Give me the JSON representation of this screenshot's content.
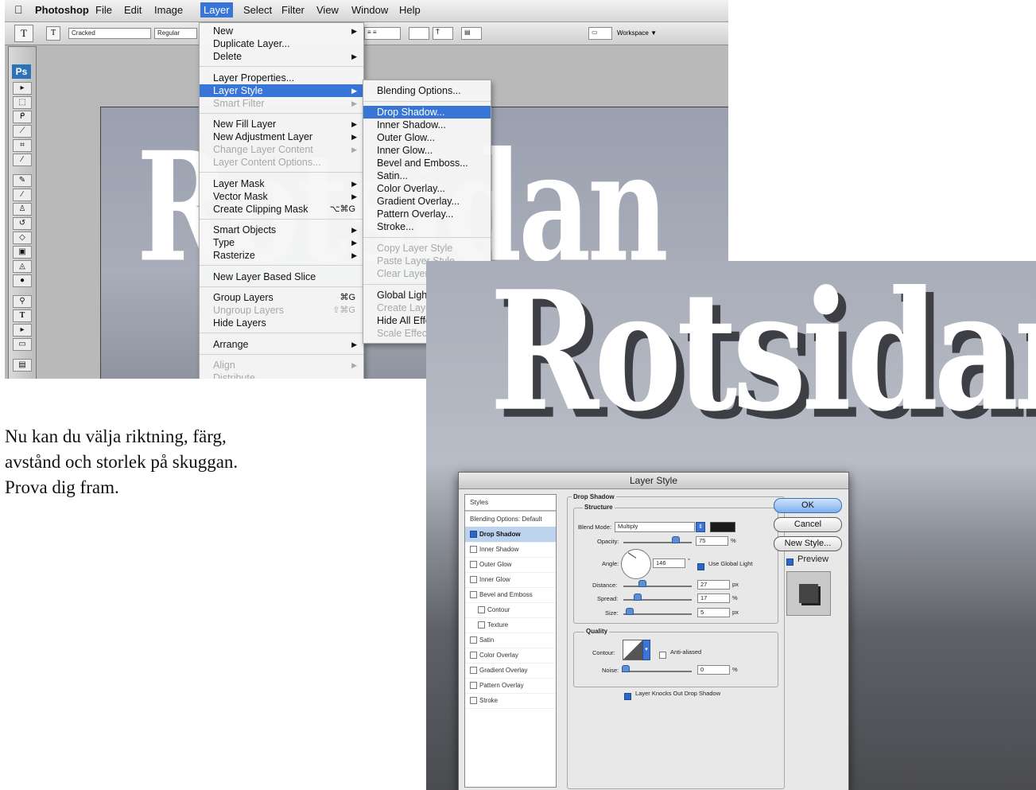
{
  "screenshot1": {
    "menubar": {
      "app": "Photoshop",
      "items": [
        "File",
        "Edit",
        "Image",
        "Layer",
        "Select",
        "Filter",
        "View",
        "Window",
        "Help"
      ],
      "active": "Layer"
    },
    "options_bar": {
      "tool_icon": "T",
      "font_family": "Cracked",
      "font_style": "Regular",
      "workspace": "Workspace ▼"
    },
    "toolbox": {
      "logo": "Ps"
    },
    "canvas_text": "Rotsidan",
    "layer_menu": [
      {
        "label": "New",
        "submenu": true
      },
      {
        "label": "Duplicate Layer..."
      },
      {
        "label": "Delete",
        "submenu": true
      },
      {
        "label": "Layer Properties..."
      },
      {
        "label": "Layer Style",
        "submenu": true,
        "highlighted": true
      },
      {
        "label": "Smart Filter",
        "disabled": true,
        "submenu": true
      },
      {
        "label": "New Fill Layer",
        "submenu": true
      },
      {
        "label": "New Adjustment Layer",
        "submenu": true
      },
      {
        "label": "Change Layer Content",
        "disabled": true,
        "submenu": true
      },
      {
        "label": "Layer Content Options...",
        "disabled": true
      },
      {
        "label": "Layer Mask",
        "submenu": true
      },
      {
        "label": "Vector Mask",
        "submenu": true
      },
      {
        "label": "Create Clipping Mask",
        "shortcut": "⌥⌘G"
      },
      {
        "label": "Smart Objects",
        "submenu": true
      },
      {
        "label": "Type",
        "submenu": true
      },
      {
        "label": "Rasterize",
        "submenu": true
      },
      {
        "label": "New Layer Based Slice"
      },
      {
        "label": "Group Layers",
        "shortcut": "⌘G"
      },
      {
        "label": "Ungroup Layers",
        "disabled": true,
        "shortcut": "⇧⌘G"
      },
      {
        "label": "Hide Layers"
      },
      {
        "label": "Arrange",
        "submenu": true
      },
      {
        "label": "Align",
        "disabled": true,
        "submenu": true
      },
      {
        "label": "Distribute",
        "disabled": true
      }
    ],
    "layer_style_submenu": [
      {
        "label": "Blending Options..."
      },
      {
        "label": "Drop Shadow...",
        "highlighted": true
      },
      {
        "label": "Inner Shadow..."
      },
      {
        "label": "Outer Glow..."
      },
      {
        "label": "Inner Glow..."
      },
      {
        "label": "Bevel and Emboss..."
      },
      {
        "label": "Satin..."
      },
      {
        "label": "Color Overlay..."
      },
      {
        "label": "Gradient Overlay..."
      },
      {
        "label": "Pattern Overlay..."
      },
      {
        "label": "Stroke..."
      },
      {
        "label": "Copy Layer Style",
        "disabled": true
      },
      {
        "label": "Paste Layer Style",
        "disabled": true
      },
      {
        "label": "Clear Layer Style",
        "disabled": true
      },
      {
        "label": "Global Light..."
      },
      {
        "label": "Create Layers",
        "disabled": true
      },
      {
        "label": "Hide All Effects"
      },
      {
        "label": "Scale Effects...",
        "disabled": true
      }
    ]
  },
  "instruction_text": [
    "Nu kan du välja riktning, färg,",
    "avstånd och storlek på skuggan.",
    "Prova dig fram."
  ],
  "screenshot2": {
    "canvas_text": "Rotsidan",
    "dialog": {
      "title": "Layer Style",
      "styles_header": "Styles",
      "style_items": [
        {
          "label": "Blending Options: Default",
          "checkbox": false
        },
        {
          "label": "Drop Shadow",
          "checkbox": true,
          "checked": true,
          "selected": true
        },
        {
          "label": "Inner Shadow",
          "checkbox": true,
          "checked": false
        },
        {
          "label": "Outer Glow",
          "checkbox": true,
          "checked": false
        },
        {
          "label": "Inner Glow",
          "checkbox": true,
          "checked": false
        },
        {
          "label": "Bevel and Emboss",
          "checkbox": true,
          "checked": false
        },
        {
          "label": "Contour",
          "checkbox": true,
          "checked": false,
          "indent": true
        },
        {
          "label": "Texture",
          "checkbox": true,
          "checked": false,
          "indent": true
        },
        {
          "label": "Satin",
          "checkbox": true,
          "checked": false
        },
        {
          "label": "Color Overlay",
          "checkbox": true,
          "checked": false
        },
        {
          "label": "Gradient Overlay",
          "checkbox": true,
          "checked": false
        },
        {
          "label": "Pattern Overlay",
          "checkbox": true,
          "checked": false
        },
        {
          "label": "Stroke",
          "checkbox": true,
          "checked": false
        }
      ],
      "drop_shadow": {
        "heading": "Drop Shadow",
        "structure": "Structure",
        "blend_mode_label": "Blend Mode:",
        "blend_mode": "Multiply",
        "shadow_color": "#1a1a1a",
        "opacity_label": "Opacity:",
        "opacity": "75",
        "angle_label": "Angle:",
        "angle": "146",
        "use_global_light": "Use Global Light",
        "distance_label": "Distance:",
        "distance": "27",
        "spread_label": "Spread:",
        "spread": "17",
        "size_label": "Size:",
        "size": "5",
        "unit_px": "px",
        "unit_pct": "%",
        "degree": "°",
        "quality": "Quality",
        "contour_label": "Contour:",
        "anti_aliased": "Anti-aliased",
        "noise_label": "Noise:",
        "noise": "0",
        "knockout": "Layer Knocks Out Drop Shadow"
      },
      "buttons": {
        "ok": "OK",
        "cancel": "Cancel",
        "new_style": "New Style..."
      },
      "preview": "Preview"
    }
  }
}
